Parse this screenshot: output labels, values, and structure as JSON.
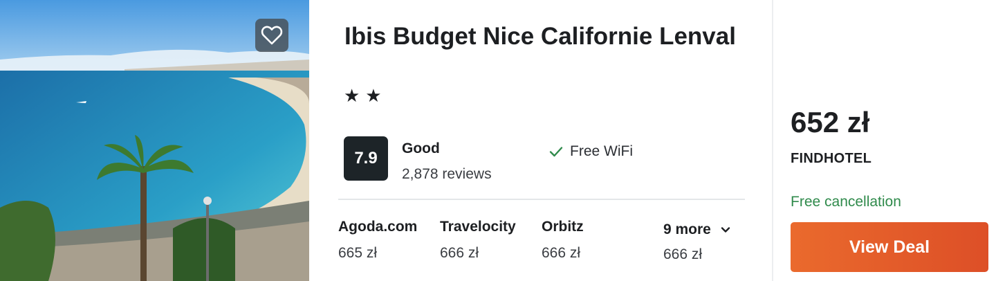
{
  "hotel": {
    "name": "Ibis Budget Nice Californie Lenval",
    "stars_text": "★★",
    "star_count": 2,
    "photo_alt": "beach-view-photo"
  },
  "rating": {
    "score": "7.9",
    "label": "Good",
    "reviews": "2,878 reviews"
  },
  "amenities": [
    {
      "icon": "check-icon",
      "label": "Free WiFi"
    }
  ],
  "providers": [
    {
      "name": "Agoda.com",
      "price": "665 zł"
    },
    {
      "name": "Travelocity",
      "price": "666 zł"
    },
    {
      "name": "Orbitz",
      "price": "666 zł"
    }
  ],
  "more_providers": {
    "label": "9 more",
    "price": "666 zł",
    "icon": "chevron-down-icon"
  },
  "deal": {
    "price": "652 zł",
    "partner": "FINDHOTEL",
    "cancellation": "Free cancellation",
    "button_label": "View Deal"
  },
  "colors": {
    "accent_orange": "#e55f2a",
    "cancel_green": "#2f8a4b",
    "score_bg": "#1d2428"
  }
}
